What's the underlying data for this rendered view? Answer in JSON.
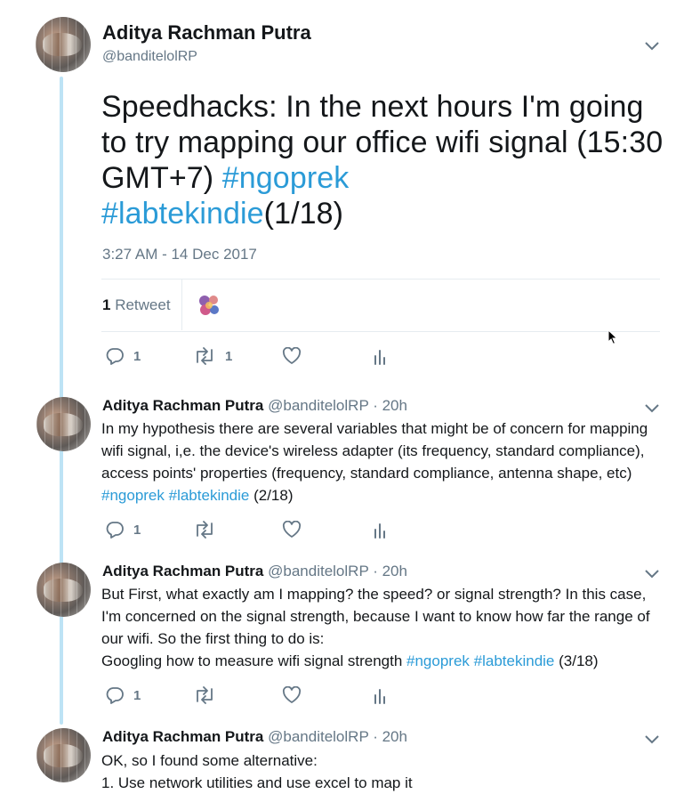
{
  "main_tweet": {
    "author_name": "Aditya Rachman Putra",
    "handle": "@banditelolRP",
    "text_plain": "Speedhacks: In the next hours I'm going to try mapping our office wifi signal (15:30 GMT+7) ",
    "hashtag1": "#ngoprek",
    "hashtag2": "#labtekindie",
    "text_suffix": "(1/18)",
    "timestamp": "3:27 AM - 14 Dec 2017",
    "retweet_count": "1",
    "retweet_label": "Retweet",
    "actions": {
      "reply_count": "1",
      "retweet_count": "1"
    }
  },
  "replies": [
    {
      "author_name": "Aditya Rachman Putra",
      "meta": "@banditelolRP · 20h",
      "text": "In my hypothesis there are several variables that might be of concern for mapping wifi signal, i,e. the device's wireless adapter (its frequency, standard compliance), access points' properties (frequency, standard compliance, antenna shape, etc) ",
      "hashtag1": "#ngoprek",
      "hashtag2": "#labtekindie",
      "suffix": " (2/18)",
      "reply_count": "1"
    },
    {
      "author_name": "Aditya Rachman Putra",
      "meta": "@banditelolRP · 20h",
      "text": "But First, what exactly am I mapping? the speed? or signal strength? In this case, I'm concerned on the signal strength, because I want to know how far the range of our wifi. So the first thing to do is:",
      "text2": "Googling how to measure wifi signal strength ",
      "hashtag1": "#ngoprek",
      "hashtag2": "#labtekindie",
      "suffix": " (3/18)",
      "reply_count": "1"
    },
    {
      "author_name": "Aditya Rachman Putra",
      "meta": "@banditelolRP · 20h",
      "text": "OK, so I found some alternative:",
      "text2": "1. Use network utilities and use excel to map it"
    }
  ],
  "icons": {
    "reply": "reply-icon",
    "retweet": "retweet-icon",
    "like": "heart-icon",
    "analytics": "analytics-icon",
    "menu": "chevron-down-icon"
  },
  "colors": {
    "hashtag": "#2b9bd7",
    "thread_line": "#bde3f5",
    "muted": "#657786"
  }
}
